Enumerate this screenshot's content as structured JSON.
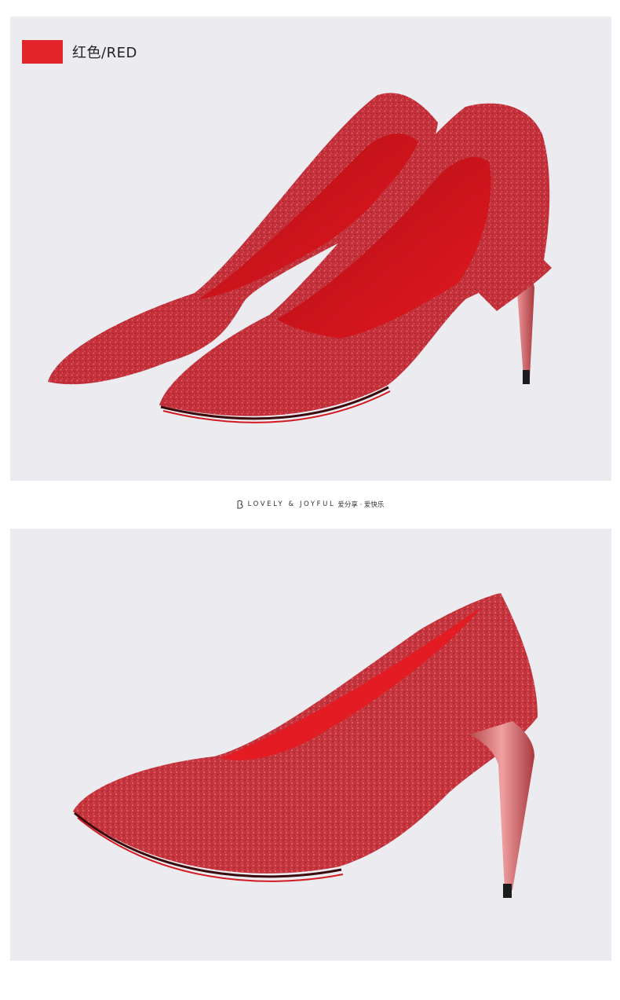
{
  "color_option": {
    "label": "红色/RED",
    "swatch_color": "#e2242b"
  },
  "divider": {
    "icon": "brand-logo-icon",
    "english": "LOVELY & JOYFUL",
    "chinese": "爱分享 · 爱快乐"
  },
  "colors": {
    "panel_background": "#ecebf0",
    "glitter_red": "#c4323a",
    "insole_red": "#e0141c",
    "heel_metallic": "#cf5a5e",
    "outsole_red": "#d31a22"
  },
  "images": [
    {
      "name": "product-photo-pair",
      "subject": "red glitter pointed-toe pumps, pair"
    },
    {
      "name": "product-photo-side",
      "subject": "red glitter pointed-toe pump, side view"
    }
  ]
}
